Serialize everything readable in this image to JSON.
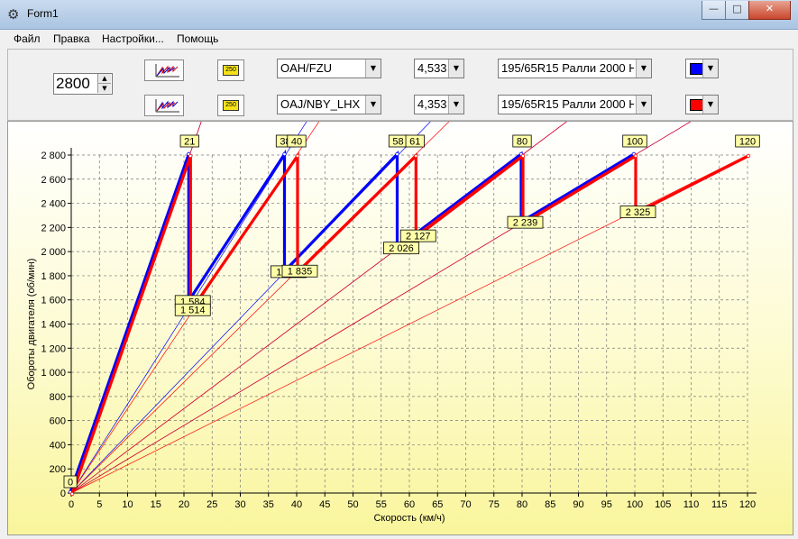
{
  "window": {
    "title": "Form1",
    "minimize_glyph": "—",
    "maximize_glyph": "□",
    "close_glyph": "✕",
    "app_icon": "gear-icon"
  },
  "menu": [
    "Файл",
    "Правка",
    "Настройки...",
    "Помощь"
  ],
  "toolbar": {
    "rpm_value": "2800",
    "gauge_label": "250",
    "rows": [
      {
        "gearbox": "OAH/FZU",
        "final_drive": "4,533",
        "tire": "195/65R15 Ралли 2000 Н",
        "color": "#0000ff"
      },
      {
        "gearbox": "OAJ/NBY_LHX",
        "final_drive": "4,353",
        "tire": "195/65R15 Ралли 2000 Н",
        "color": "#ff0000"
      }
    ]
  },
  "chart_data": {
    "type": "line",
    "xlabel": "Скорость (км/ч)",
    "ylabel": "Обороты двигателя (об/мин)",
    "xlim": [
      0,
      120
    ],
    "ylim": [
      0,
      2800
    ],
    "x_ticks": [
      0,
      5,
      10,
      15,
      20,
      25,
      30,
      35,
      40,
      45,
      50,
      55,
      60,
      65,
      70,
      75,
      80,
      85,
      90,
      95,
      100,
      105,
      110,
      115,
      120
    ],
    "y_ticks": [
      0,
      200,
      400,
      600,
      800,
      1000,
      1200,
      1400,
      1600,
      1800,
      2000,
      2200,
      2400,
      2600,
      2800
    ],
    "y_tick_labels": [
      "0",
      "200",
      "400",
      "600",
      "800",
      "1 000",
      "1 200",
      "1 400",
      "1 600",
      "1 800",
      "2 000",
      "2 200",
      "2 400",
      "2 600",
      "2 800"
    ],
    "grid": true,
    "series": [
      {
        "color": "#0000ff",
        "shifts": [
          {
            "shift_speed": 21,
            "drop_rpm": 1584
          },
          {
            "shift_speed": 38,
            "drop_rpm": 1830
          },
          {
            "shift_speed": 58,
            "drop_rpm": 2026
          },
          {
            "shift_speed": 80,
            "drop_rpm": 2239
          },
          {
            "shift_speed": 100
          }
        ]
      },
      {
        "color": "#ff0000",
        "shifts": [
          {
            "shift_speed": 21,
            "drop_rpm": 1514
          },
          {
            "shift_speed": 40,
            "drop_rpm": 1835
          },
          {
            "shift_speed": 61,
            "drop_rpm": 2127
          },
          {
            "shift_speed": 80,
            "drop_rpm": 2239
          },
          {
            "shift_speed": 100,
            "drop_rpm": 2325
          },
          {
            "shift_speed": 120
          }
        ]
      }
    ],
    "annotations": [
      {
        "x": 0,
        "y": 0,
        "text": "0"
      },
      {
        "x": 21,
        "y": 2800,
        "text": "21"
      },
      {
        "x": 38,
        "y": 2800,
        "text": "38"
      },
      {
        "x": 40,
        "y": 2800,
        "text": "40"
      },
      {
        "x": 58,
        "y": 2800,
        "text": "58"
      },
      {
        "x": 61,
        "y": 2800,
        "text": "61"
      },
      {
        "x": 80,
        "y": 2800,
        "text": "80"
      },
      {
        "x": 100,
        "y": 2800,
        "text": "100"
      },
      {
        "x": 120,
        "y": 2800,
        "text": "120"
      },
      {
        "x": 21,
        "y": 1584,
        "text": "1 584"
      },
      {
        "x": 21,
        "y": 1514,
        "text": "1 514"
      },
      {
        "x": 38,
        "y": 1830,
        "text": "1 830"
      },
      {
        "x": 40,
        "y": 1835,
        "text": "1 835"
      },
      {
        "x": 58,
        "y": 2026,
        "text": "2 026"
      },
      {
        "x": 61,
        "y": 2127,
        "text": "2 127"
      },
      {
        "x": 80,
        "y": 2239,
        "text": "2 239"
      },
      {
        "x": 100,
        "y": 2325,
        "text": "2 325"
      }
    ]
  }
}
